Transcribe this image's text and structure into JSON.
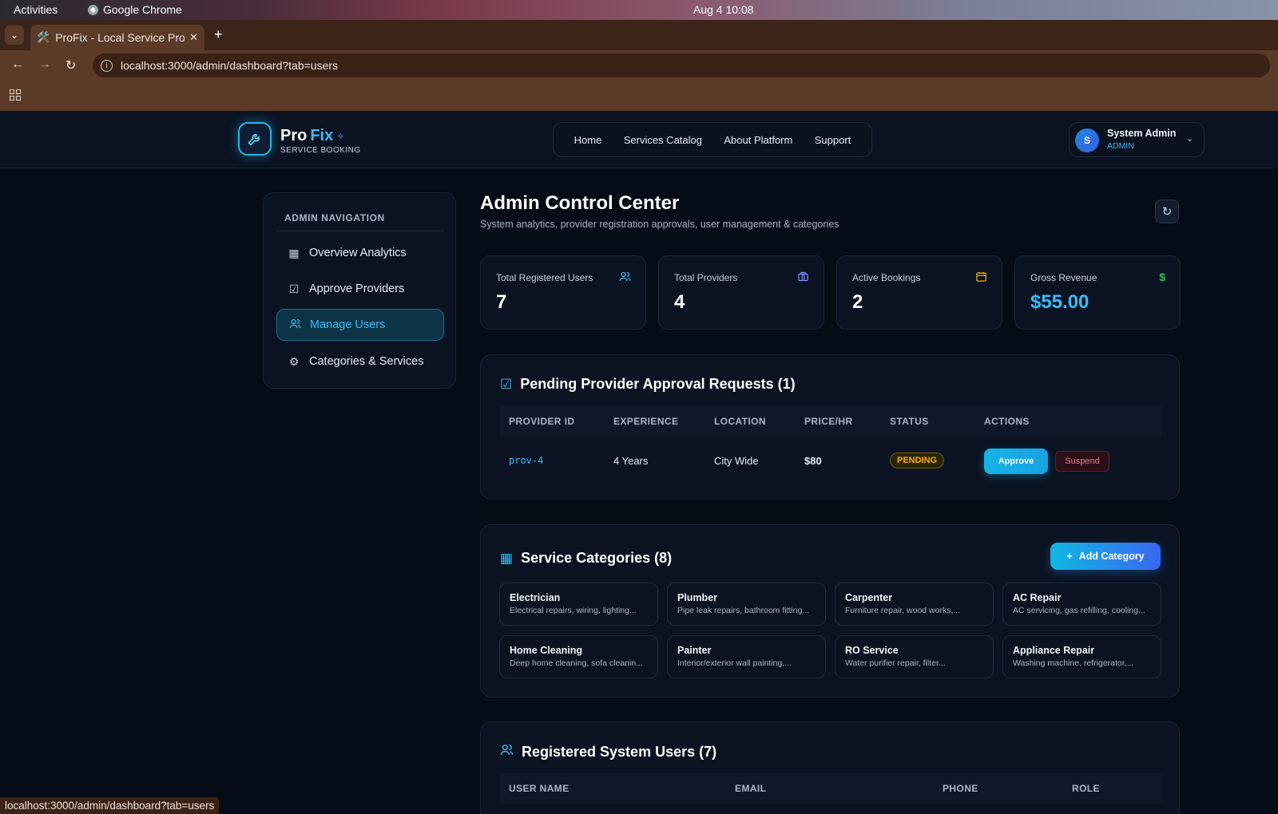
{
  "os": {
    "activities": "Activities",
    "app_name": "Google Chrome",
    "clock": "Aug 4  10:08"
  },
  "browser": {
    "tab_icon": "🛠️",
    "tab_title": "ProFix - Local Service Pro",
    "url": "localhost:3000/admin/dashboard?tab=users",
    "status_url": "localhost:3000/admin/dashboard?tab=users"
  },
  "header": {
    "logo_pro": "Pro",
    "logo_fix": "Fix",
    "logo_sub": "SERVICE BOOKING",
    "nav": [
      "Home",
      "Services Catalog",
      "About Platform",
      "Support"
    ],
    "user": {
      "initial": "S",
      "name": "System Admin",
      "role": "ADMIN"
    }
  },
  "sidebar": {
    "title": "ADMIN NAVIGATION",
    "items": [
      {
        "label": "Overview Analytics",
        "icon": "grid-icon"
      },
      {
        "label": "Approve Providers",
        "icon": "check-square-icon"
      },
      {
        "label": "Manage Users",
        "icon": "users-icon",
        "active": true
      },
      {
        "label": "Categories & Services",
        "icon": "gear-icon"
      }
    ]
  },
  "main": {
    "title": "Admin Control Center",
    "subtitle": "System analytics, provider registration approvals, user management & categories",
    "stats": [
      {
        "label": "Total Registered Users",
        "value": "7",
        "icon": "users-icon",
        "color": "#38bdf8"
      },
      {
        "label": "Total Providers",
        "value": "4",
        "icon": "briefcase-icon",
        "color": "#818cf8"
      },
      {
        "label": "Active Bookings",
        "value": "2",
        "icon": "calendar-icon",
        "color": "#f5b301"
      },
      {
        "label": "Gross Revenue",
        "value": "$55.00",
        "icon": "dollar-icon",
        "color": "#22c55e"
      }
    ]
  },
  "pending": {
    "title": "Pending Provider Approval Requests (1)",
    "columns": [
      "PROVIDER ID",
      "EXPERIENCE",
      "LOCATION",
      "PRICE/HR",
      "STATUS",
      "ACTIONS"
    ],
    "rows": [
      {
        "id": "prov-4",
        "experience": "4 Years",
        "location": "City Wide",
        "price": "$80",
        "status": "PENDING",
        "approve": "Approve",
        "suspend": "Suspend"
      }
    ]
  },
  "categories": {
    "title": "Service Categories (8)",
    "add_label": "Add Category",
    "items": [
      {
        "name": "Electrician",
        "desc": "Electrical repairs, wiring, lighting..."
      },
      {
        "name": "Plumber",
        "desc": "Pipe leak repairs, bathroom fitting..."
      },
      {
        "name": "Carpenter",
        "desc": "Furniture repair, wood works,..."
      },
      {
        "name": "AC Repair",
        "desc": "AC servicing, gas refilling, cooling..."
      },
      {
        "name": "Home Cleaning",
        "desc": "Deep home cleaning, sofa cleanin..."
      },
      {
        "name": "Painter",
        "desc": "Interior/exterior wall painting,..."
      },
      {
        "name": "RO Service",
        "desc": "Water purifier repair, filter..."
      },
      {
        "name": "Appliance Repair",
        "desc": "Washing machine, refrigerator,..."
      }
    ]
  },
  "users": {
    "title": "Registered System Users (7)",
    "columns": [
      "USER NAME",
      "EMAIL",
      "PHONE",
      "ROLE"
    ]
  }
}
